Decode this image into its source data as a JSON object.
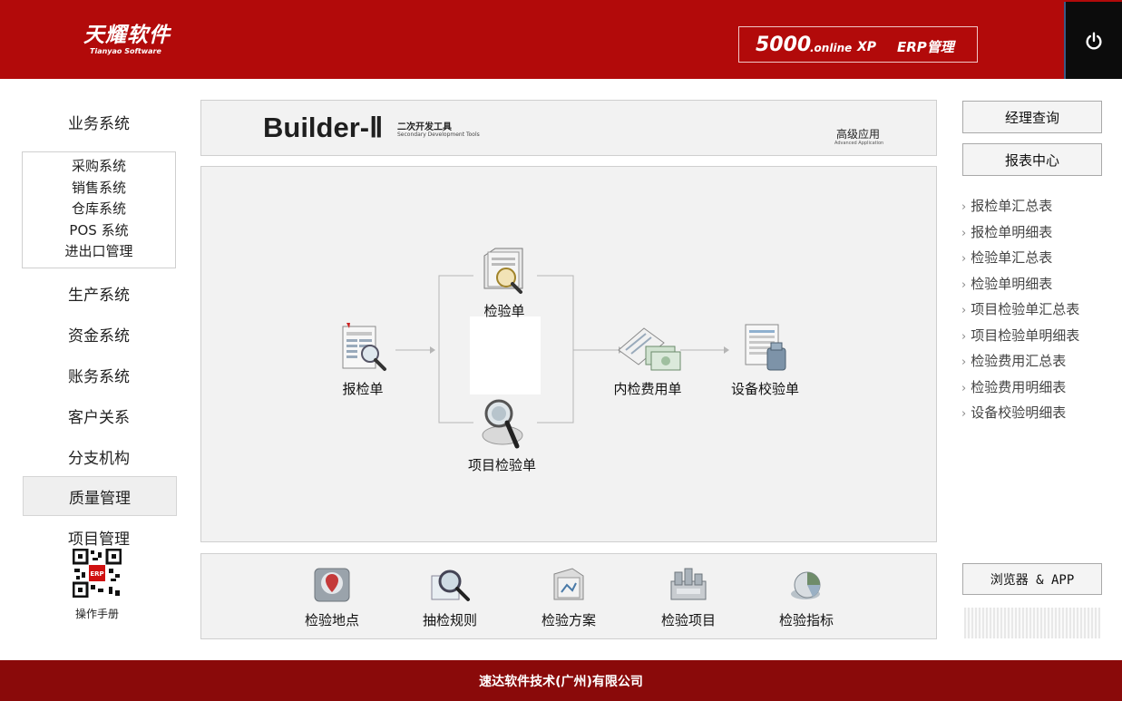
{
  "header": {
    "logo_cn": "天耀软件",
    "logo_en": "Tianyao Software",
    "product_num": "5000",
    "product_online": ".online",
    "product_xp": "XP",
    "product_erp": "ERP管理",
    "power_icon": "power-icon"
  },
  "nav": {
    "business": "业务系统",
    "sub_items": [
      "采购系统",
      "销售系统",
      "仓库系统",
      "POS 系统",
      "进出口管理"
    ],
    "production": "生产系统",
    "funds": "资金系统",
    "accounting": "账务系统",
    "customer": "客户关系",
    "branch": "分支机构",
    "quality": "质量管理",
    "project": "项目管理",
    "manual": "操作手册"
  },
  "banner": {
    "name": "Builder-Ⅱ",
    "subtitle_cn": "二次开发工具",
    "subtitle_en": "Secondary Development Tools",
    "advanced_cn": "高级应用",
    "advanced_en": "Advanced Application"
  },
  "flow": {
    "report_inspection": "报检单",
    "inspection": "检验单",
    "item_inspection": "项目检验单",
    "internal_fee": "内检费用单",
    "equipment_calibration": "设备校验单"
  },
  "tools": [
    "检验地点",
    "抽检规则",
    "检验方案",
    "检验项目",
    "检验指标"
  ],
  "right": {
    "manager_query": "经理查询",
    "report_center": "报表中心",
    "reports": [
      "报检单汇总表",
      "报检单明细表",
      "检验单汇总表",
      "检验单明细表",
      "项目检验单汇总表",
      "项目检验单明细表",
      "检验费用汇总表",
      "检验费用明细表",
      "设备校验明细表"
    ],
    "browser_app": "浏览器 & APP"
  },
  "footer": {
    "company": "速达软件技术(广州)有限公司"
  },
  "colors": {
    "header_red": "#b20a0a",
    "footer_red": "#8a0a0a",
    "panel_gray": "#f2f2f2"
  }
}
